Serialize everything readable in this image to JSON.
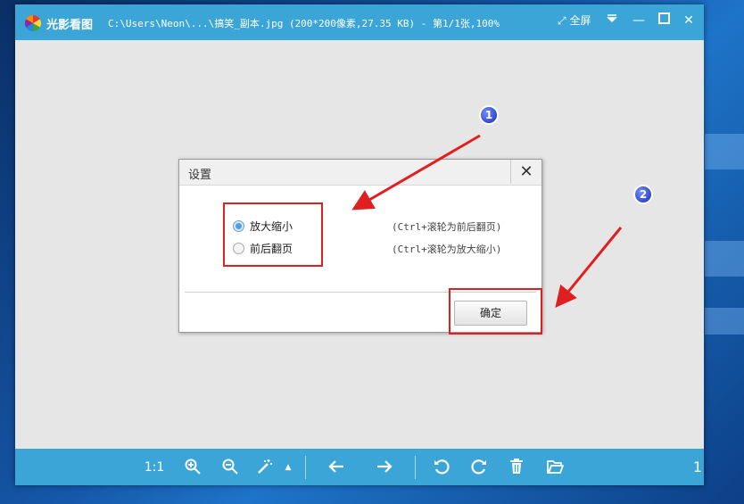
{
  "titlebar": {
    "app_name": "光影看图",
    "file_info": "C:\\Users\\Neon\\...\\搞笑_副本.jpg (200*200像素,27.35 KB) - 第1/1张,100%",
    "fullscreen_label": "全屏",
    "menu_glyph": "⩡",
    "minimize_glyph": "—",
    "maximize_glyph": "☐",
    "close_glyph": "✕"
  },
  "dialog": {
    "title": "设置",
    "close_glyph": "✕",
    "options": [
      {
        "label": "放大缩小",
        "hint": "(Ctrl+滚轮为前后翻页)",
        "checked": true
      },
      {
        "label": "前后翻页",
        "hint": "(Ctrl+滚轮为放大缩小)",
        "checked": false
      }
    ],
    "ok_label": "确定"
  },
  "annotations": {
    "marker1": "1",
    "marker2": "2",
    "color": "#e02020"
  },
  "toolbar": {
    "actual_size_label": "1:1",
    "page_indicator": "1",
    "icons": [
      "zoom-in-icon",
      "zoom-out-icon",
      "magic-wand-icon",
      "caret-up-icon",
      "arrow-left-icon",
      "arrow-right-icon",
      "rotate-left-icon",
      "rotate-right-icon",
      "trash-icon",
      "folder-open-icon"
    ]
  },
  "colors": {
    "accent": "#3aa5d6",
    "canvas": "#e6e6e6"
  }
}
